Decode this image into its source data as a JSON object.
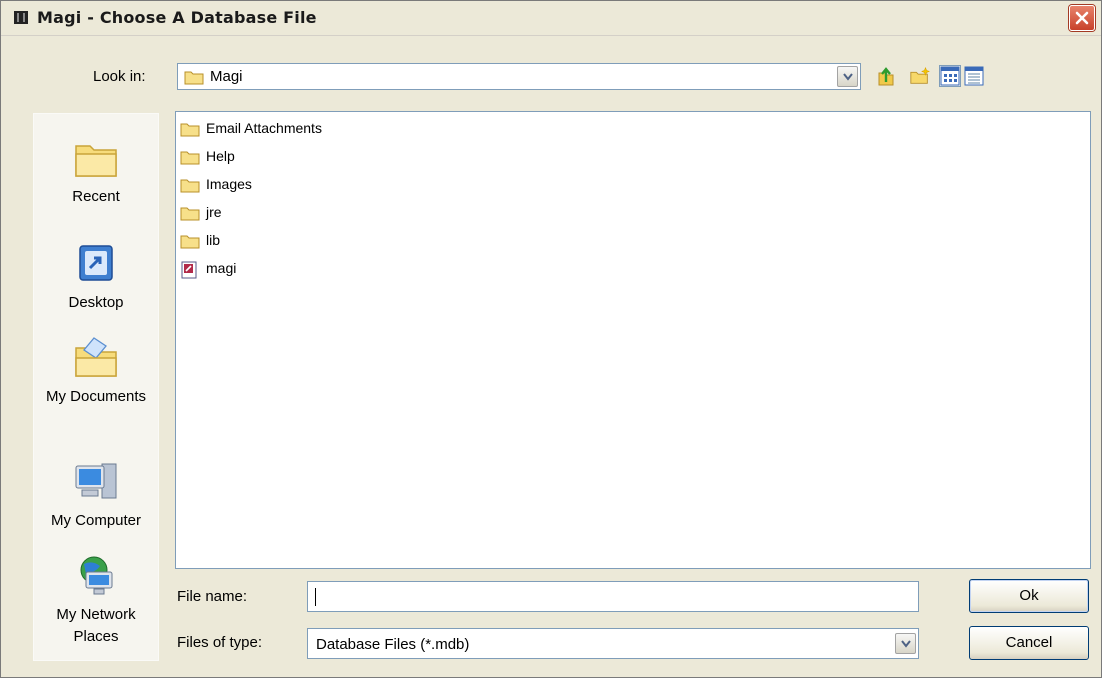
{
  "window": {
    "title": "Magi - Choose A Database File"
  },
  "lookin": {
    "label": "Look in:",
    "value": "Magi"
  },
  "toolbar": {
    "icons": [
      "up-one-level-icon",
      "new-folder-icon",
      "list-view-icon",
      "details-view-icon"
    ]
  },
  "places": [
    {
      "label": "Recent",
      "icon": "recent-folder-icon"
    },
    {
      "label": "Desktop",
      "icon": "desktop-icon"
    },
    {
      "label": "My Documents",
      "icon": "my-documents-icon"
    },
    {
      "label": "My Computer",
      "icon": "my-computer-icon"
    },
    {
      "label": "My Network Places",
      "icon": "network-places-icon"
    }
  ],
  "files": [
    {
      "name": "Email Attachments",
      "type": "folder"
    },
    {
      "name": "Help",
      "type": "folder"
    },
    {
      "name": "Images",
      "type": "folder"
    },
    {
      "name": "jre",
      "type": "folder"
    },
    {
      "name": "lib",
      "type": "folder"
    },
    {
      "name": "magi",
      "type": "database"
    }
  ],
  "form": {
    "filename_label": "File name:",
    "filename_value": "",
    "filetype_label": "Files of type:",
    "filetype_value": "Database Files (*.mdb)"
  },
  "buttons": {
    "ok": "Ok",
    "cancel": "Cancel"
  },
  "colors": {
    "dialog_bg": "#ece9d8",
    "border_blue": "#7f9db9",
    "close_red": "#c8412a"
  }
}
